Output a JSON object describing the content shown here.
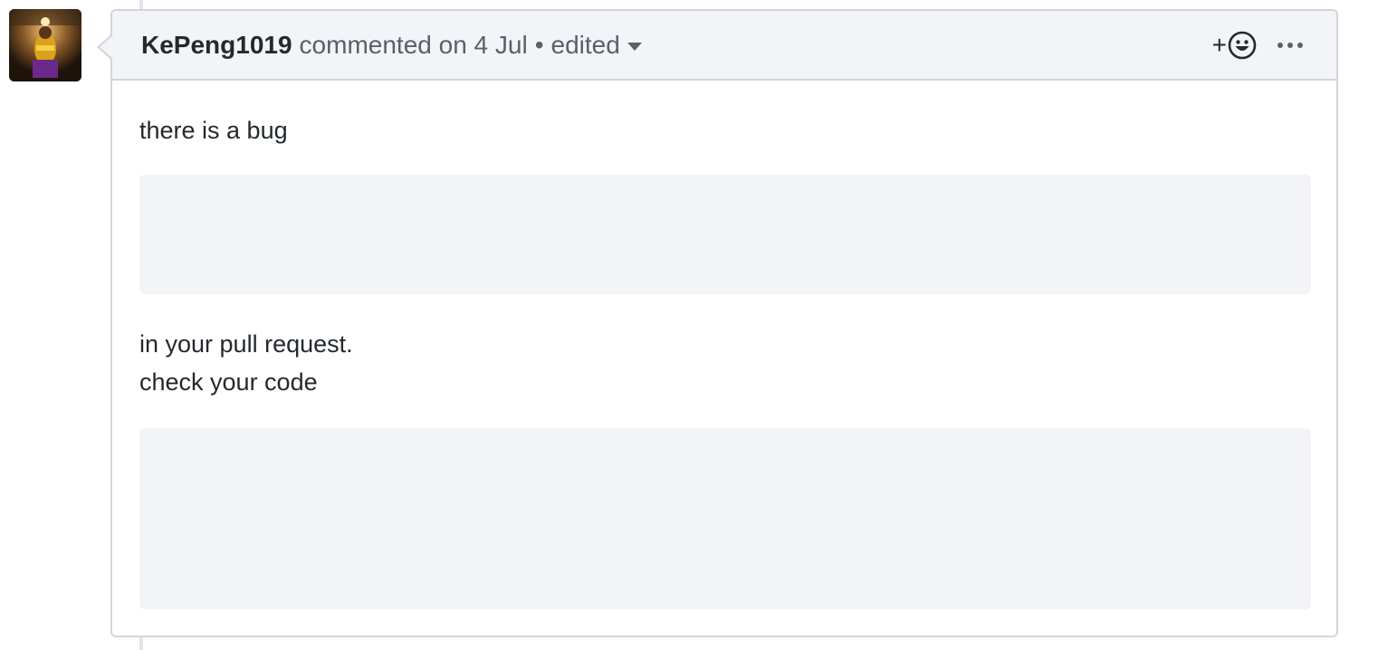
{
  "comment": {
    "author": "KePeng1019",
    "action": "commented on 4 Jul",
    "separator": "•",
    "edited_label": "edited",
    "reaction_plus": "+",
    "body": {
      "line1": "there is a bug",
      "line2": "in your pull request.",
      "line3": "check your code"
    }
  },
  "colors": {
    "header_bg": "#f3f4f8",
    "border": "#d1d5da",
    "text": "#24292e",
    "muted": "#586069",
    "code_bg": "#f3f4f8"
  },
  "icons": {
    "reaction": "smiley-icon",
    "more": "kebab-horizontal-icon",
    "dropdown": "triangle-down-icon"
  }
}
